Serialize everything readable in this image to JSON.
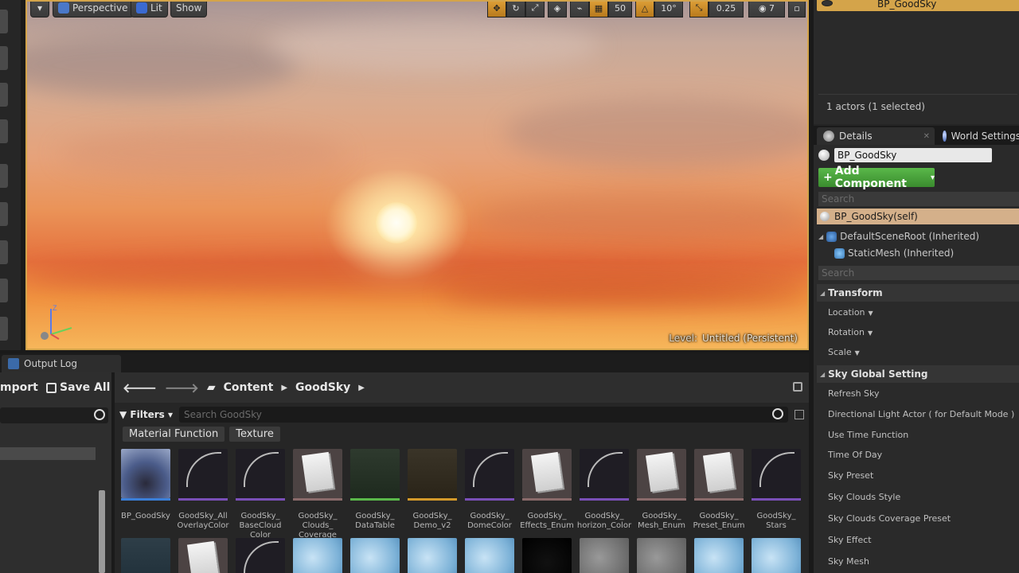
{
  "viewport": {
    "perspective_label": "Perspective",
    "lit_label": "Lit",
    "show_label": "Show",
    "grid_snap": "50",
    "rotation_snap": "10°",
    "scale_snap": "0.25",
    "camera_speed": "7",
    "level_label": "Level:",
    "level_value": "Untitled (Persistent)",
    "axis_z": "Z"
  },
  "output_log": {
    "tab_label": "Output Log"
  },
  "content_browser": {
    "import_label": "mport",
    "save_all_label": "Save All",
    "path": [
      "Content",
      "GoodSky"
    ],
    "filters_label": "Filters",
    "search_placeholder": "Search GoodSky",
    "chips": [
      "Material Function",
      "Texture"
    ],
    "assets_row1": [
      {
        "name": "BP_GoodSky",
        "kind": "blueprint",
        "bar": "#3b7fd8"
      },
      {
        "name": "GoodSky_All OverlayColor",
        "kind": "matfunc",
        "bar": "#7a4fb8"
      },
      {
        "name": "GoodSky_ BaseCloud Color",
        "kind": "matfunc",
        "bar": "#7a4fb8"
      },
      {
        "name": "GoodSky_ Clouds_ Coverage",
        "kind": "enum",
        "bar": "#8a6a6a"
      },
      {
        "name": "GoodSky_ DataTable",
        "kind": "datatable",
        "bar": "#5ab84a"
      },
      {
        "name": "GoodSky_ Demo_v2",
        "kind": "level",
        "bar": "#d49a2a"
      },
      {
        "name": "GoodSky_ DomeColor",
        "kind": "matfunc",
        "bar": "#7a4fb8"
      },
      {
        "name": "GoodSky_ Effects_Enum",
        "kind": "enum",
        "bar": "#8a6a6a"
      },
      {
        "name": "GoodSky_ horizon_Color",
        "kind": "matfunc",
        "bar": "#7a4fb8"
      },
      {
        "name": "GoodSky_ Mesh_Enum",
        "kind": "enum",
        "bar": "#8a6a6a"
      },
      {
        "name": "GoodSky_ Preset_Enum",
        "kind": "enum",
        "bar": "#8a6a6a"
      },
      {
        "name": "GoodSky_ Stars",
        "kind": "matfunc",
        "bar": "#7a4fb8"
      }
    ],
    "assets_row2": [
      "struct",
      "enum",
      "matfunc",
      "tex",
      "tex",
      "tex",
      "tex",
      "black",
      "grey",
      "grey",
      "tex",
      "tex"
    ]
  },
  "outliner": {
    "selected_item": "BP_GoodSky",
    "count_text": "1 actors (1 selected)"
  },
  "details": {
    "tab_details": "Details",
    "tab_world": "World Settings",
    "object_name": "BP_GoodSky",
    "add_component_label": "Add Component",
    "search_placeholder": "Search",
    "self_row": "BP_GoodSky(self)",
    "root_row": "DefaultSceneRoot (Inherited)",
    "mesh_row": "StaticMesh (Inherited)",
    "search2_placeholder": "Search",
    "transform_section": "Transform",
    "transform_props": [
      "Location",
      "Rotation",
      "Scale"
    ],
    "sky_section": "Sky Global Setting",
    "sky_props": [
      "Refresh Sky",
      "Directional Light Actor ( for Default Mode )",
      "Use Time Function",
      "Time Of Day",
      "Sky Preset",
      "Sky Clouds Style",
      "Sky Clouds Coverage Preset",
      "Sky Effect",
      "Sky Mesh"
    ]
  }
}
